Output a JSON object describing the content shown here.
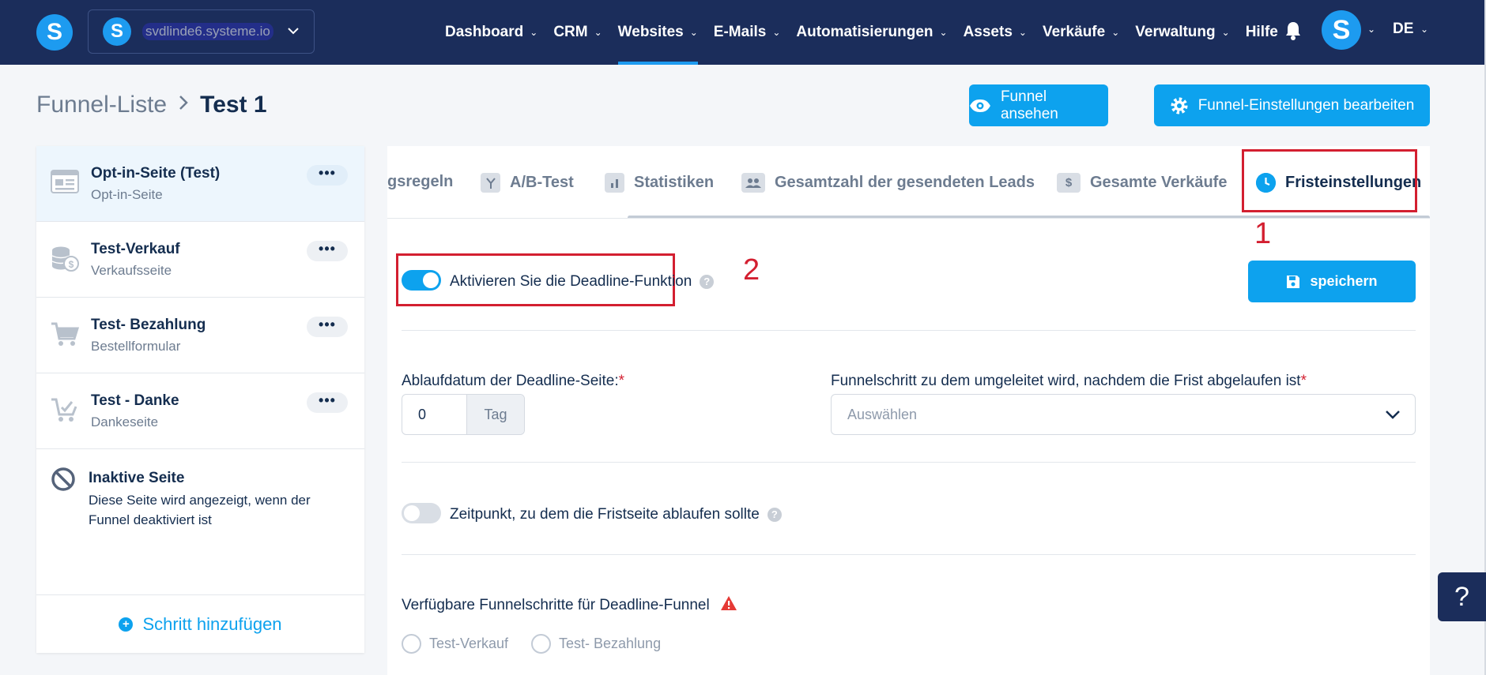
{
  "nav": {
    "logo_letter": "S",
    "account_letter": "S",
    "account_site": "svdlinde6.systeme.io",
    "menu": [
      {
        "label": "Dashboard",
        "active": false
      },
      {
        "label": "CRM",
        "active": false
      },
      {
        "label": "Websites",
        "active": true
      },
      {
        "label": "E-Mails",
        "active": false
      },
      {
        "label": "Automatisierungen",
        "active": false
      },
      {
        "label": "Assets",
        "active": false
      },
      {
        "label": "Verkäufe",
        "active": false
      },
      {
        "label": "Verwaltung",
        "active": false
      },
      {
        "label": "Hilfe",
        "active": false
      }
    ],
    "avatar_letter": "S",
    "language": "DE"
  },
  "breadcrumb": {
    "parent": "Funnel-Liste",
    "separator": ">",
    "current": "Test 1"
  },
  "header_buttons": {
    "view_funnel": "Funnel ansehen",
    "edit_settings": "Funnel-Einstellungen bearbeiten"
  },
  "steps": [
    {
      "title": "Opt-in-Seite (Test)",
      "subtitle": "Opt-in-Seite",
      "icon": "page-icon",
      "active": true,
      "menu": "•••"
    },
    {
      "title": "Test-Verkauf",
      "subtitle": "Verkaufsseite",
      "icon": "coins-icon",
      "active": false,
      "menu": "•••"
    },
    {
      "title": "Test- Bezahlung",
      "subtitle": "Bestellformular",
      "icon": "cart-icon",
      "active": false,
      "menu": "•••"
    },
    {
      "title": "Test - Danke",
      "subtitle": "Dankeseite",
      "icon": "cart-check-icon",
      "active": false,
      "menu": "•••"
    }
  ],
  "inactive_page": {
    "title": "Inaktive Seite",
    "description": "Diese Seite wird angezeigt, wenn der Funnel deaktiviert ist"
  },
  "add_step_label": "Schritt hinzufügen",
  "tabs": [
    {
      "label": "gsregeln",
      "icon": "none"
    },
    {
      "label": "A/B-Test",
      "icon": "split-icon"
    },
    {
      "label": "Statistiken",
      "icon": "bar-chart-icon"
    },
    {
      "label": "Gesamtzahl der gesendeten Leads",
      "icon": "users-icon"
    },
    {
      "label": "Gesamte Verkäufe",
      "icon": "dollar-icon"
    },
    {
      "label": "Fristeinstellungen",
      "icon": "clock-icon",
      "active": true
    }
  ],
  "annotations": {
    "one": "1",
    "two": "2"
  },
  "deadline": {
    "enable_label": "Aktivieren Sie die Deadline-Funktion",
    "enabled": true,
    "save_label": "speichern",
    "expiry_label": "Ablaufdatum der Deadline-Seite:",
    "expiry_value": "0",
    "expiry_unit": "Tag",
    "redirect_label": "Funnelschritt zu dem umgeleitet wird, nachdem die Frist abgelaufen ist",
    "redirect_placeholder": "Auswählen",
    "required_mark": "*",
    "time_label": "Zeitpunkt, zu dem die Fristseite ablaufen sollte",
    "time_enabled": false,
    "available_label": "Verfügbare Funnelschritte für Deadline-Funnel",
    "available_steps": [
      "Test-Verkauf",
      "Test- Bezahlung"
    ],
    "help_mark": "?"
  },
  "help_button": "?",
  "colors": {
    "navbar": "#1b2d5b",
    "accent": "#0da2ee",
    "annotation": "#d31f30"
  }
}
